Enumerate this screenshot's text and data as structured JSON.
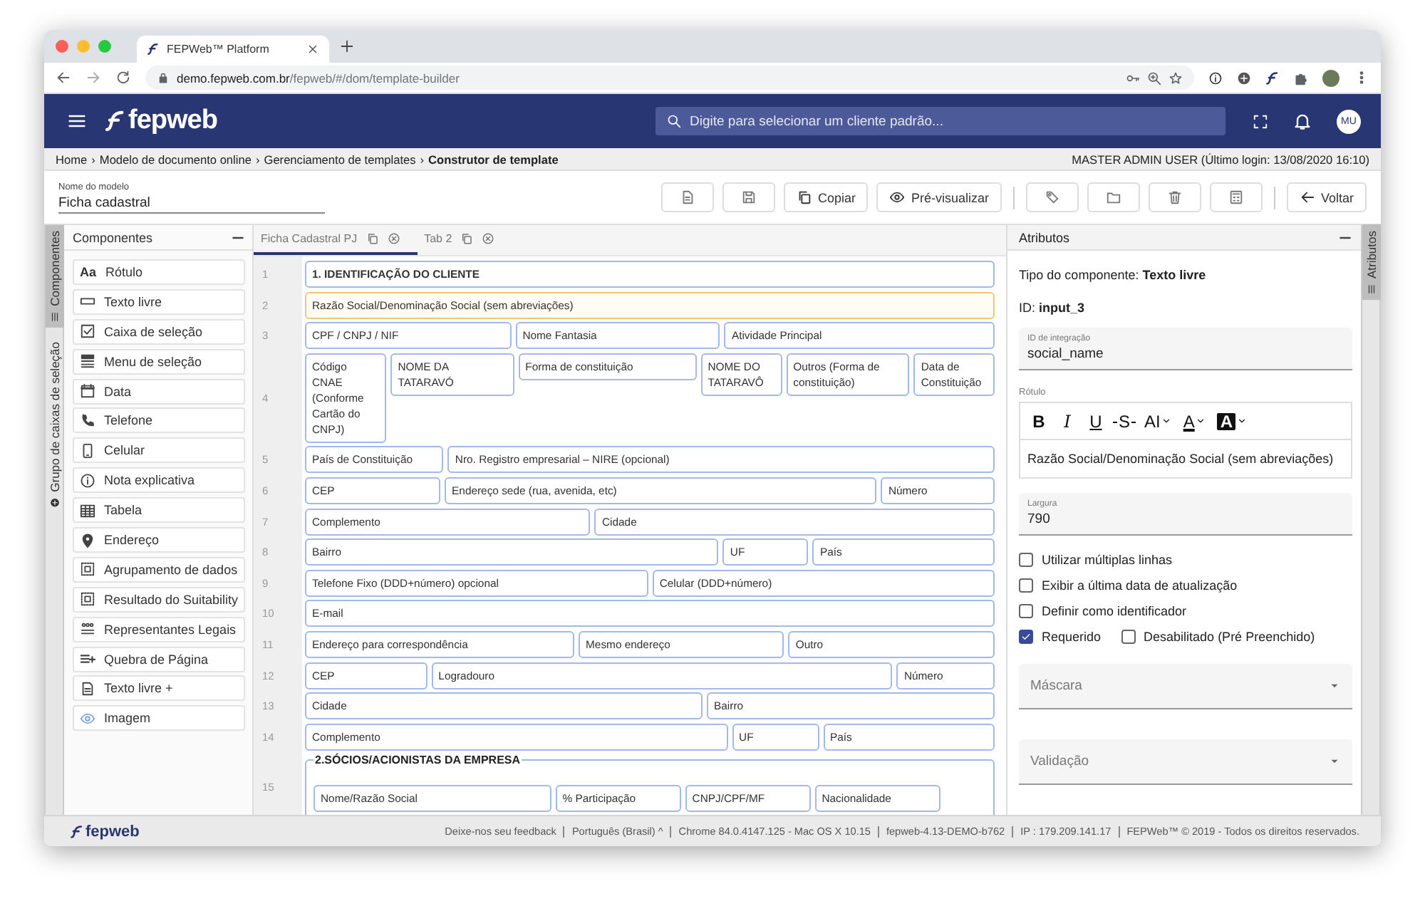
{
  "browser": {
    "tab_title": "FEPWeb™ Platform",
    "url_host": "demo.fepweb.com.br",
    "url_path": "/fepweb/#/dom/template-builder"
  },
  "header": {
    "logo": "fepweb",
    "search_placeholder": "Digite para selecionar um cliente padrão...",
    "avatar": "MU"
  },
  "breadcrumb": {
    "items": [
      {
        "label": "Home",
        "separator": "›"
      },
      {
        "label": "Modelo de documento online",
        "separator": "›"
      },
      {
        "label": "Gerenciamento de templates",
        "separator": "›"
      }
    ],
    "current": "Construtor de template",
    "user": "MASTER ADMIN USER (Último login: 13/08/2020 16:10)"
  },
  "toolbar": {
    "name_label": "Nome do modelo",
    "name_value": "Ficha cadastral",
    "button_groups": [
      [
        {
          "kind": "new"
        },
        {
          "kind": "save"
        },
        {
          "kind": "copy",
          "label": "Copiar"
        },
        {
          "kind": "preview",
          "label": "Pré-visualizar"
        }
      ],
      [
        {
          "kind": "tag"
        },
        {
          "kind": "folder"
        },
        {
          "kind": "delete"
        },
        {
          "kind": "calculator"
        }
      ],
      [
        {
          "kind": "back",
          "label": "Voltar"
        }
      ]
    ]
  },
  "left_side_tabs": [
    {
      "label": "Componentes",
      "selected": true
    },
    {
      "label": "Grupo de caixas de seleção",
      "selected": false
    }
  ],
  "components_panel": {
    "title": "Componentes",
    "items": [
      {
        "label": "Rótulo",
        "kind": "label",
        "glyph": "Aa"
      },
      {
        "label": "Texto livre",
        "kind": "text"
      },
      {
        "label": "Caixa de seleção",
        "kind": "checkbox"
      },
      {
        "label": "Menu de seleção",
        "kind": "select"
      },
      {
        "label": "Data",
        "kind": "date"
      },
      {
        "label": "Telefone",
        "kind": "phone"
      },
      {
        "label": "Celular",
        "kind": "mobile"
      },
      {
        "label": "Nota explicativa",
        "kind": "note"
      },
      {
        "label": "Tabela",
        "kind": "table"
      },
      {
        "label": "Endereço",
        "kind": "address"
      },
      {
        "label": "Agrupamento de dados",
        "kind": "grouping"
      },
      {
        "label": "Resultado do Suitability",
        "kind": "grouping"
      },
      {
        "label": "Representantes Legais",
        "kind": "people"
      },
      {
        "label": "Quebra de Página",
        "kind": "pagebreak"
      },
      {
        "label": "Texto livre +",
        "kind": "richtext"
      },
      {
        "label": "Imagem",
        "kind": "image"
      }
    ]
  },
  "editor_tabs": [
    {
      "label": "Ficha Cadastral PJ",
      "selected": true
    },
    {
      "label": "Tab 2",
      "selected": false
    }
  ],
  "form": {
    "rows": [
      {
        "number": "1",
        "kind": "fields",
        "fields": [
          {
            "label": "1. IDENTIFICAÇÃO DO CLIENTE",
            "kind": "heading",
            "selected": false
          }
        ]
      },
      {
        "number": "2",
        "kind": "fields",
        "fields": [
          {
            "label": "Razão Social/Denominação Social (sem abreviações)",
            "kind": "field",
            "selected": true
          }
        ]
      },
      {
        "number": "3",
        "kind": "fields",
        "fields": [
          {
            "label": "CPF / CNPJ / NIF",
            "kind": "field",
            "selected": false
          },
          {
            "label": "Nome Fantasia",
            "kind": "field",
            "selected": false
          },
          {
            "label": "Atividade Principal",
            "kind": "field",
            "selected": false
          }
        ]
      },
      {
        "number": "4",
        "kind": "fields",
        "fields": [
          {
            "label": "Código CNAE (Conforme Cartão do CNPJ)",
            "kind": "field",
            "selected": false
          },
          {
            "label": "NOME DA TATARAVÓ",
            "kind": "field",
            "selected": false
          },
          {
            "label": "Forma de constituição",
            "kind": "field",
            "selected": false
          },
          {
            "label": "NOME DO TATARAVÔ",
            "kind": "field",
            "selected": false
          },
          {
            "label": "Outros (Forma de constituição)",
            "kind": "field",
            "selected": false
          },
          {
            "label": "Data de Constituição",
            "kind": "field",
            "selected": false
          }
        ]
      },
      {
        "number": "5",
        "kind": "fields",
        "fields": [
          {
            "label": "País de Constituição",
            "kind": "field",
            "selected": false
          },
          {
            "label": "Nro. Registro empresarial – NIRE (opcional)",
            "kind": "field",
            "selected": false
          }
        ]
      },
      {
        "number": "6",
        "kind": "fields",
        "fields": [
          {
            "label": "CEP",
            "kind": "field",
            "selected": false
          },
          {
            "label": "Endereço sede (rua, avenida, etc)",
            "kind": "field",
            "selected": false
          },
          {
            "label": "Número",
            "kind": "field",
            "selected": false
          }
        ]
      },
      {
        "number": "7",
        "kind": "fields",
        "fields": [
          {
            "label": "Complemento",
            "kind": "field",
            "selected": false
          },
          {
            "label": "Cidade",
            "kind": "field",
            "selected": false
          }
        ]
      },
      {
        "number": "8",
        "kind": "fields",
        "fields": [
          {
            "label": "Bairro",
            "kind": "field",
            "selected": false
          },
          {
            "label": "UF",
            "kind": "field",
            "selected": false
          },
          {
            "label": "País",
            "kind": "field",
            "selected": false
          }
        ]
      },
      {
        "number": "9",
        "kind": "fields",
        "fields": [
          {
            "label": "Telefone Fixo (DDD+número) opcional",
            "kind": "field",
            "selected": false
          },
          {
            "label": "Celular (DDD+número)",
            "kind": "field",
            "selected": false
          }
        ]
      },
      {
        "number": "10",
        "kind": "fields",
        "fields": [
          {
            "label": "E-mail",
            "kind": "field",
            "selected": false
          }
        ]
      },
      {
        "number": "11",
        "kind": "fields",
        "fields": [
          {
            "label": "Endereço para correspondência",
            "kind": "field",
            "selected": false
          },
          {
            "label": "Mesmo endereço",
            "kind": "field",
            "selected": false
          },
          {
            "label": "Outro",
            "kind": "field",
            "selected": false
          }
        ]
      },
      {
        "number": "12",
        "kind": "fields",
        "fields": [
          {
            "label": "CEP",
            "kind": "field",
            "selected": false
          },
          {
            "label": "Logradouro",
            "kind": "field",
            "selected": false
          },
          {
            "label": "Número",
            "kind": "field",
            "selected": false
          }
        ]
      },
      {
        "number": "13",
        "kind": "fields",
        "fields": [
          {
            "label": "Cidade",
            "kind": "field",
            "selected": false
          },
          {
            "label": "Bairro",
            "kind": "field",
            "selected": false
          }
        ]
      },
      {
        "number": "14",
        "kind": "fields",
        "fields": [
          {
            "label": "Complemento",
            "kind": "field",
            "selected": false
          },
          {
            "label": "UF",
            "kind": "field",
            "selected": false
          },
          {
            "label": "País",
            "kind": "field",
            "selected": false
          }
        ]
      },
      {
        "number": "15",
        "kind": "group",
        "title": "2.SÓCIOS/ACIONISTAS DA EMPRESA",
        "fields": [
          {
            "label": "Nome/Razão Social",
            "kind": "field",
            "selected": false
          },
          {
            "label": "% Participação",
            "kind": "field",
            "selected": false
          },
          {
            "label": "CNPJ/CPF/MF",
            "kind": "field",
            "selected": false
          },
          {
            "label": "Nacionalidade",
            "kind": "field",
            "selected": false
          }
        ]
      }
    ]
  },
  "attributes": {
    "title": "Atributos",
    "type_line": "Tipo do componente: **Texto livre**",
    "id_line": "ID: **input_3**",
    "integration_field": {
      "label": "ID de integração",
      "value": "social_name"
    },
    "label_editor": {
      "label": "Rótulo",
      "format_buttons": [
        {
          "kind": "bold",
          "glyph": "B",
          "dropdown": false
        },
        {
          "kind": "italic",
          "glyph": "I",
          "dropdown": false
        },
        {
          "kind": "underline",
          "glyph": "U",
          "dropdown": false
        },
        {
          "kind": "strike",
          "glyph": "S",
          "dropdown": false
        },
        {
          "kind": "size",
          "glyph": "AI",
          "dropdown": true
        },
        {
          "kind": "color",
          "glyph": "A",
          "dropdown": true
        },
        {
          "kind": "highlight",
          "glyph": "A",
          "dropdown": true
        }
      ],
      "content": "Razão Social/Denominação Social (sem abreviações)"
    },
    "width_field": {
      "label": "Largura",
      "value": "790"
    },
    "option_rows": [
      [
        {
          "label": "Utilizar múltiplas linhas",
          "checked": false
        }
      ],
      [
        {
          "label": "Exibir a última data de atualização",
          "checked": false
        }
      ],
      [
        {
          "label": "Definir como identificador",
          "checked": false
        }
      ],
      [
        {
          "label": "Requerido",
          "checked": true
        },
        {
          "label": "Desabilitado (Pré Preenchido)",
          "checked": false
        }
      ]
    ],
    "selects": [
      {
        "placeholder": "Máscara"
      },
      {
        "placeholder": "Validação"
      }
    ]
  },
  "right_side_tabs": [
    {
      "label": "Atributos",
      "selected": true
    }
  ],
  "footer": {
    "logo": "fepweb",
    "links": [
      "Deixe-nos seu feedback",
      "Português (Brasil) ^"
    ],
    "items": [
      "Chrome 84.0.4147.125 - Mac OS X 10.15",
      "fepweb-4.13-DEMO-b762",
      "IP : 179.209.141.17",
      "FEPWeb™ © 2019 - Todos os direitos reservados."
    ]
  }
}
